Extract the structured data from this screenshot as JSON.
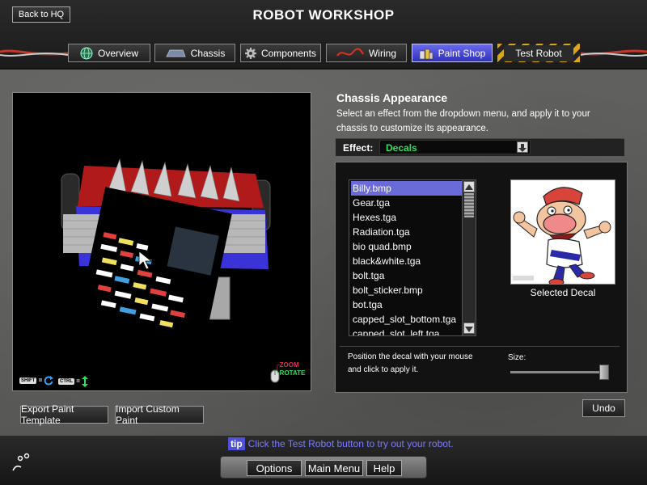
{
  "header": {
    "back_label": "Back to HQ",
    "title": "ROBOT WORKSHOP",
    "tabs": [
      {
        "label": "Overview",
        "icon": "globe-icon"
      },
      {
        "label": "Chassis",
        "icon": "chassis-icon"
      },
      {
        "label": "Components",
        "icon": "gear-icon"
      },
      {
        "label": "Wiring",
        "icon": "wire-icon"
      },
      {
        "label": "Paint Shop",
        "icon": "paint-cans-icon",
        "active": true
      },
      {
        "label": "Test Robot",
        "icon": "",
        "style": "hazard"
      }
    ]
  },
  "viewport": {
    "shift_key": "SHIFT",
    "ctrl_key": "CTRL",
    "zoom_label": "ZOOM",
    "rotate_label": "ROTATE"
  },
  "left_buttons": {
    "export_label": "Export Paint Template",
    "import_label": "Import Custom Paint"
  },
  "panel": {
    "title": "Chassis Appearance",
    "description": "Select an effect from the dropdown menu, and apply it to your chassis to customize its appearance.",
    "effect_label": "Effect:",
    "effect_value": "Decals",
    "decals": [
      "Billy.bmp",
      "Gear.tga",
      "Hexes.tga",
      "Radiation.tga",
      "bio quad.bmp",
      "black&white.tga",
      "bolt.tga",
      "bolt_sticker.bmp",
      "bot.tga",
      "capped_slot_bottom.tga",
      "capped_slot_left.tga"
    ],
    "selected_index": 0,
    "selected_caption": "Selected Decal",
    "position_hint": "Position the decal with your mouse and click to apply it.",
    "size_label": "Size:",
    "size_value": 1.0,
    "undo_label": "Undo"
  },
  "footer": {
    "tip_badge": "tip",
    "tip_text": "Click the Test Robot button to try out your robot.",
    "options_label": "Options",
    "main_menu_label": "Main Menu",
    "help_label": "Help"
  },
  "colors": {
    "accent": "#6a6ad8",
    "effect_green": "#21e35a",
    "tip_blue": "#7a7aff"
  }
}
